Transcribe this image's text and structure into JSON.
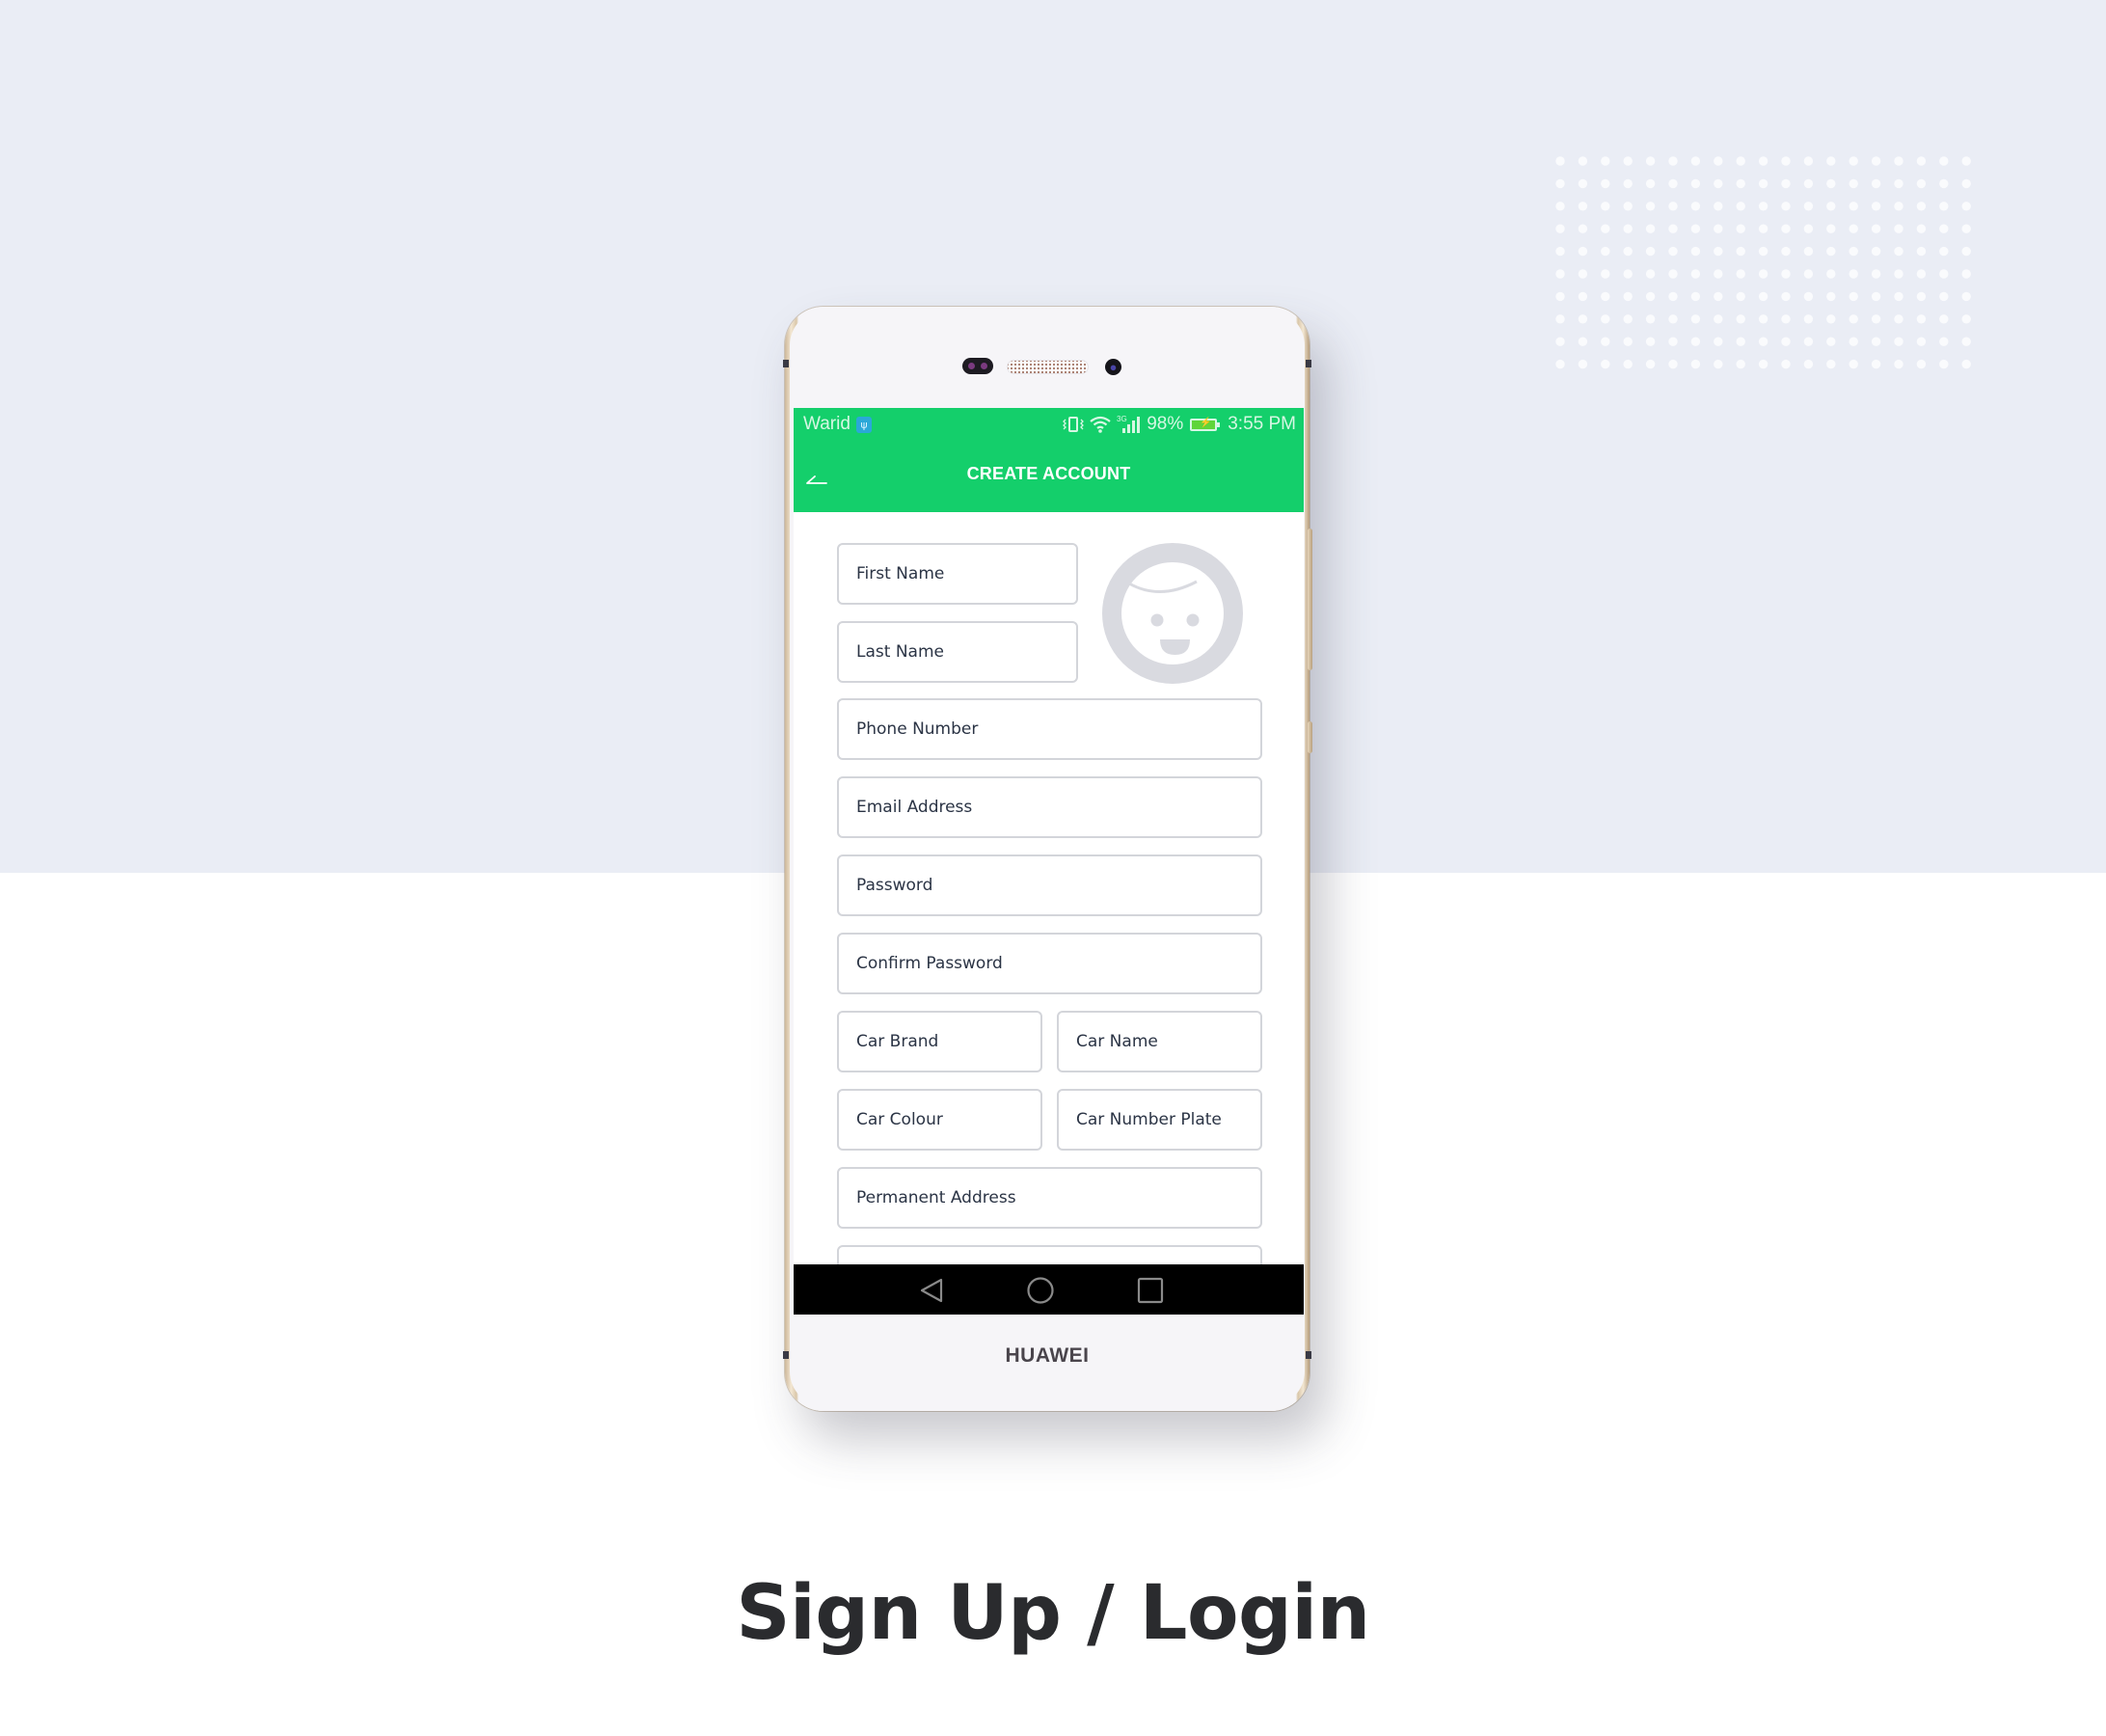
{
  "page": {
    "title": "Sign Up / Login",
    "background_top_color": "#EAEDF5",
    "background_bottom_color": "#FFFFFF"
  },
  "device": {
    "brand": "HUAWEI"
  },
  "status_bar": {
    "carrier": "Warid",
    "usb_icon": "usb-icon",
    "network_label": "3G",
    "battery_percent": "98%",
    "time": "3:55 PM"
  },
  "app_bar": {
    "title": "CREATE ACCOUNT",
    "back_icon": "back-arrow-icon",
    "color": "#14CF6B"
  },
  "form": {
    "avatar_icon": "user-avatar-placeholder",
    "fields": {
      "first_name": {
        "placeholder": "First Name",
        "value": ""
      },
      "last_name": {
        "placeholder": "Last Name",
        "value": ""
      },
      "phone_number": {
        "placeholder": "Phone Number",
        "value": ""
      },
      "email_address": {
        "placeholder": "Email Address",
        "value": ""
      },
      "password": {
        "placeholder": "Password",
        "value": ""
      },
      "confirm_password": {
        "placeholder": "Confirm Password",
        "value": ""
      },
      "car_brand": {
        "placeholder": "Car Brand",
        "value": ""
      },
      "car_name": {
        "placeholder": "Car Name",
        "value": ""
      },
      "car_colour": {
        "placeholder": "Car Colour",
        "value": ""
      },
      "car_number_plate": {
        "placeholder": "Car Number Plate",
        "value": ""
      },
      "permanent_address": {
        "placeholder": "Permanent Address",
        "value": ""
      },
      "next_field": {
        "placeholder": "",
        "value": ""
      }
    }
  },
  "nav_bar": {
    "back": "nav-back-icon",
    "home": "nav-home-icon",
    "recents": "nav-recents-icon"
  }
}
